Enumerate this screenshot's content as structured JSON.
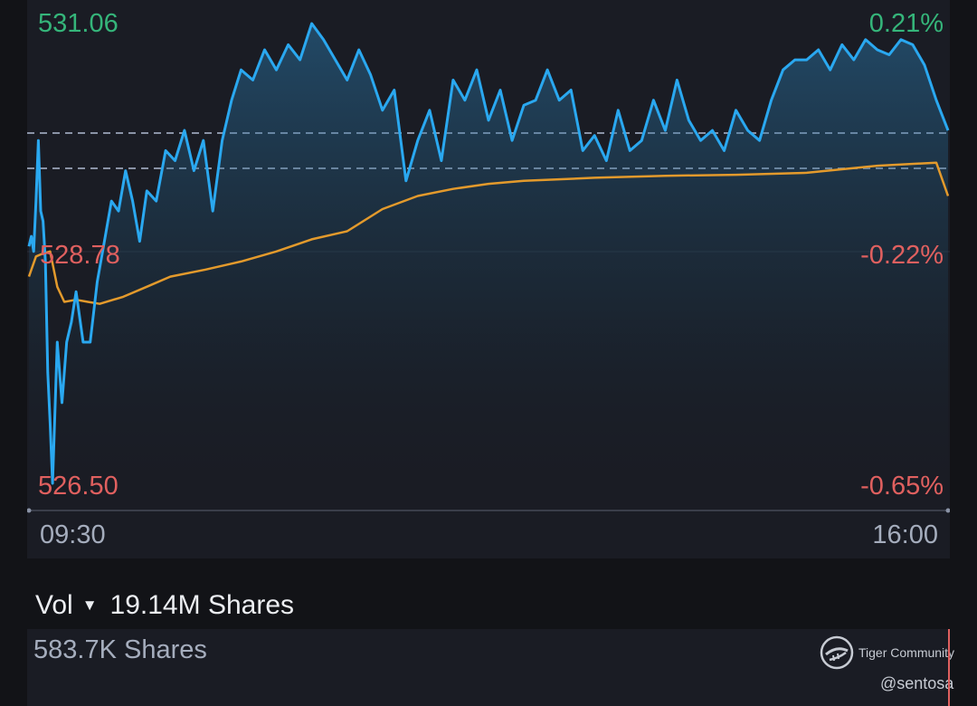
{
  "price_labels": {
    "high": "531.06",
    "low": "526.50",
    "mid": "528.78"
  },
  "pct_labels": {
    "high": "0.21%",
    "mid": "-0.22%",
    "low": "-0.65%"
  },
  "time_labels": {
    "start": "09:30",
    "end": "16:00"
  },
  "volume": {
    "label": "Vol",
    "total": "19.14M Shares",
    "current": "583.7K Shares"
  },
  "watermark": {
    "brand": "Tiger Community",
    "user": "@sentosa"
  },
  "colors": {
    "price_line": "#2aa8f0",
    "vwap_line": "#e39a2c",
    "up": "#35b57a",
    "down": "#e0605f",
    "reference_line": "#8a93a6"
  },
  "chart_data": {
    "type": "line",
    "title": "",
    "x_range": [
      "09:30",
      "16:00"
    ],
    "y_range": [
      526.5,
      531.06
    ],
    "previous_close": 529.94,
    "reference_levels": [
      530.35,
      530.0
    ],
    "series": [
      {
        "x": [
          "09:30",
          "09:31",
          "09:32",
          "09:33",
          "09:34",
          "09:35",
          "09:36",
          "09:37",
          "09:38",
          "09:39",
          "09:40",
          "09:42",
          "09:44",
          "09:46",
          "09:48",
          "09:50",
          "09:53",
          "09:56",
          "09:59",
          "10:02",
          "10:05",
          "10:08",
          "10:11",
          "10:14",
          "10:17",
          "10:20",
          "10:24",
          "10:28",
          "10:32",
          "10:36",
          "10:40",
          "10:44",
          "10:48",
          "10:52",
          "10:56",
          "11:00",
          "11:05",
          "11:10",
          "11:15",
          "11:20",
          "11:25",
          "11:30",
          "11:35",
          "11:40",
          "11:45",
          "11:50",
          "11:55",
          "12:00",
          "12:05",
          "12:10",
          "12:15",
          "12:20",
          "12:25",
          "12:30",
          "12:35",
          "12:40",
          "12:45",
          "12:50",
          "12:55",
          "13:00",
          "13:05",
          "13:10",
          "13:15",
          "13:20",
          "13:25",
          "13:30",
          "13:35",
          "13:40",
          "13:45",
          "13:50",
          "13:55",
          "14:00",
          "14:05",
          "14:10",
          "14:15",
          "14:20",
          "14:25",
          "14:30",
          "14:35",
          "14:40",
          "14:45",
          "14:50",
          "14:55",
          "15:00",
          "15:05",
          "15:10",
          "15:15",
          "15:20",
          "15:25",
          "15:30",
          "15:35",
          "15:40",
          "15:45",
          "15:50",
          "15:55",
          "16:00"
        ],
        "values": [
          528.85,
          528.95,
          528.8,
          529.3,
          529.9,
          529.2,
          529.1,
          528.7,
          527.6,
          527.1,
          526.5,
          527.9,
          527.3,
          527.9,
          528.1,
          528.4,
          527.9,
          527.9,
          528.5,
          528.9,
          529.3,
          529.2,
          529.6,
          529.3,
          528.9,
          529.4,
          529.3,
          529.8,
          529.7,
          530.0,
          529.6,
          529.9,
          529.2,
          529.9,
          530.3,
          530.6,
          530.5,
          530.8,
          530.6,
          530.85,
          530.7,
          531.06,
          530.9,
          530.7,
          530.5,
          530.8,
          530.55,
          530.2,
          530.4,
          529.5,
          529.9,
          530.2,
          529.7,
          530.5,
          530.3,
          530.6,
          530.1,
          530.4,
          529.9,
          530.25,
          530.3,
          530.6,
          530.3,
          530.4,
          529.8,
          529.95,
          529.7,
          530.2,
          529.8,
          529.9,
          530.3,
          530.0,
          530.5,
          530.1,
          529.9,
          530.0,
          529.8,
          530.2,
          530.0,
          529.9,
          530.3,
          530.6,
          530.7,
          530.7,
          530.8,
          530.6,
          530.85,
          530.7,
          530.9,
          530.8,
          530.75,
          530.9,
          530.85,
          530.65,
          530.3,
          530.0
        ]
      },
      {
        "x": [
          "09:30",
          "09:33",
          "09:36",
          "09:39",
          "09:42",
          "09:45",
          "09:50",
          "09:55",
          "10:00",
          "10:10",
          "10:20",
          "10:30",
          "10:45",
          "11:00",
          "11:15",
          "11:30",
          "11:45",
          "12:00",
          "12:15",
          "12:30",
          "12:45",
          "13:00",
          "13:30",
          "14:00",
          "14:30",
          "15:00",
          "15:30",
          "15:55",
          "16:00"
        ],
        "values": [
          528.55,
          528.75,
          528.78,
          528.8,
          528.45,
          528.3,
          528.32,
          528.3,
          528.28,
          528.35,
          528.45,
          528.55,
          528.62,
          528.7,
          528.8,
          528.92,
          529.0,
          529.22,
          529.35,
          529.42,
          529.47,
          529.5,
          529.53,
          529.55,
          529.56,
          529.58,
          529.65,
          529.68,
          529.35
        ]
      }
    ]
  }
}
